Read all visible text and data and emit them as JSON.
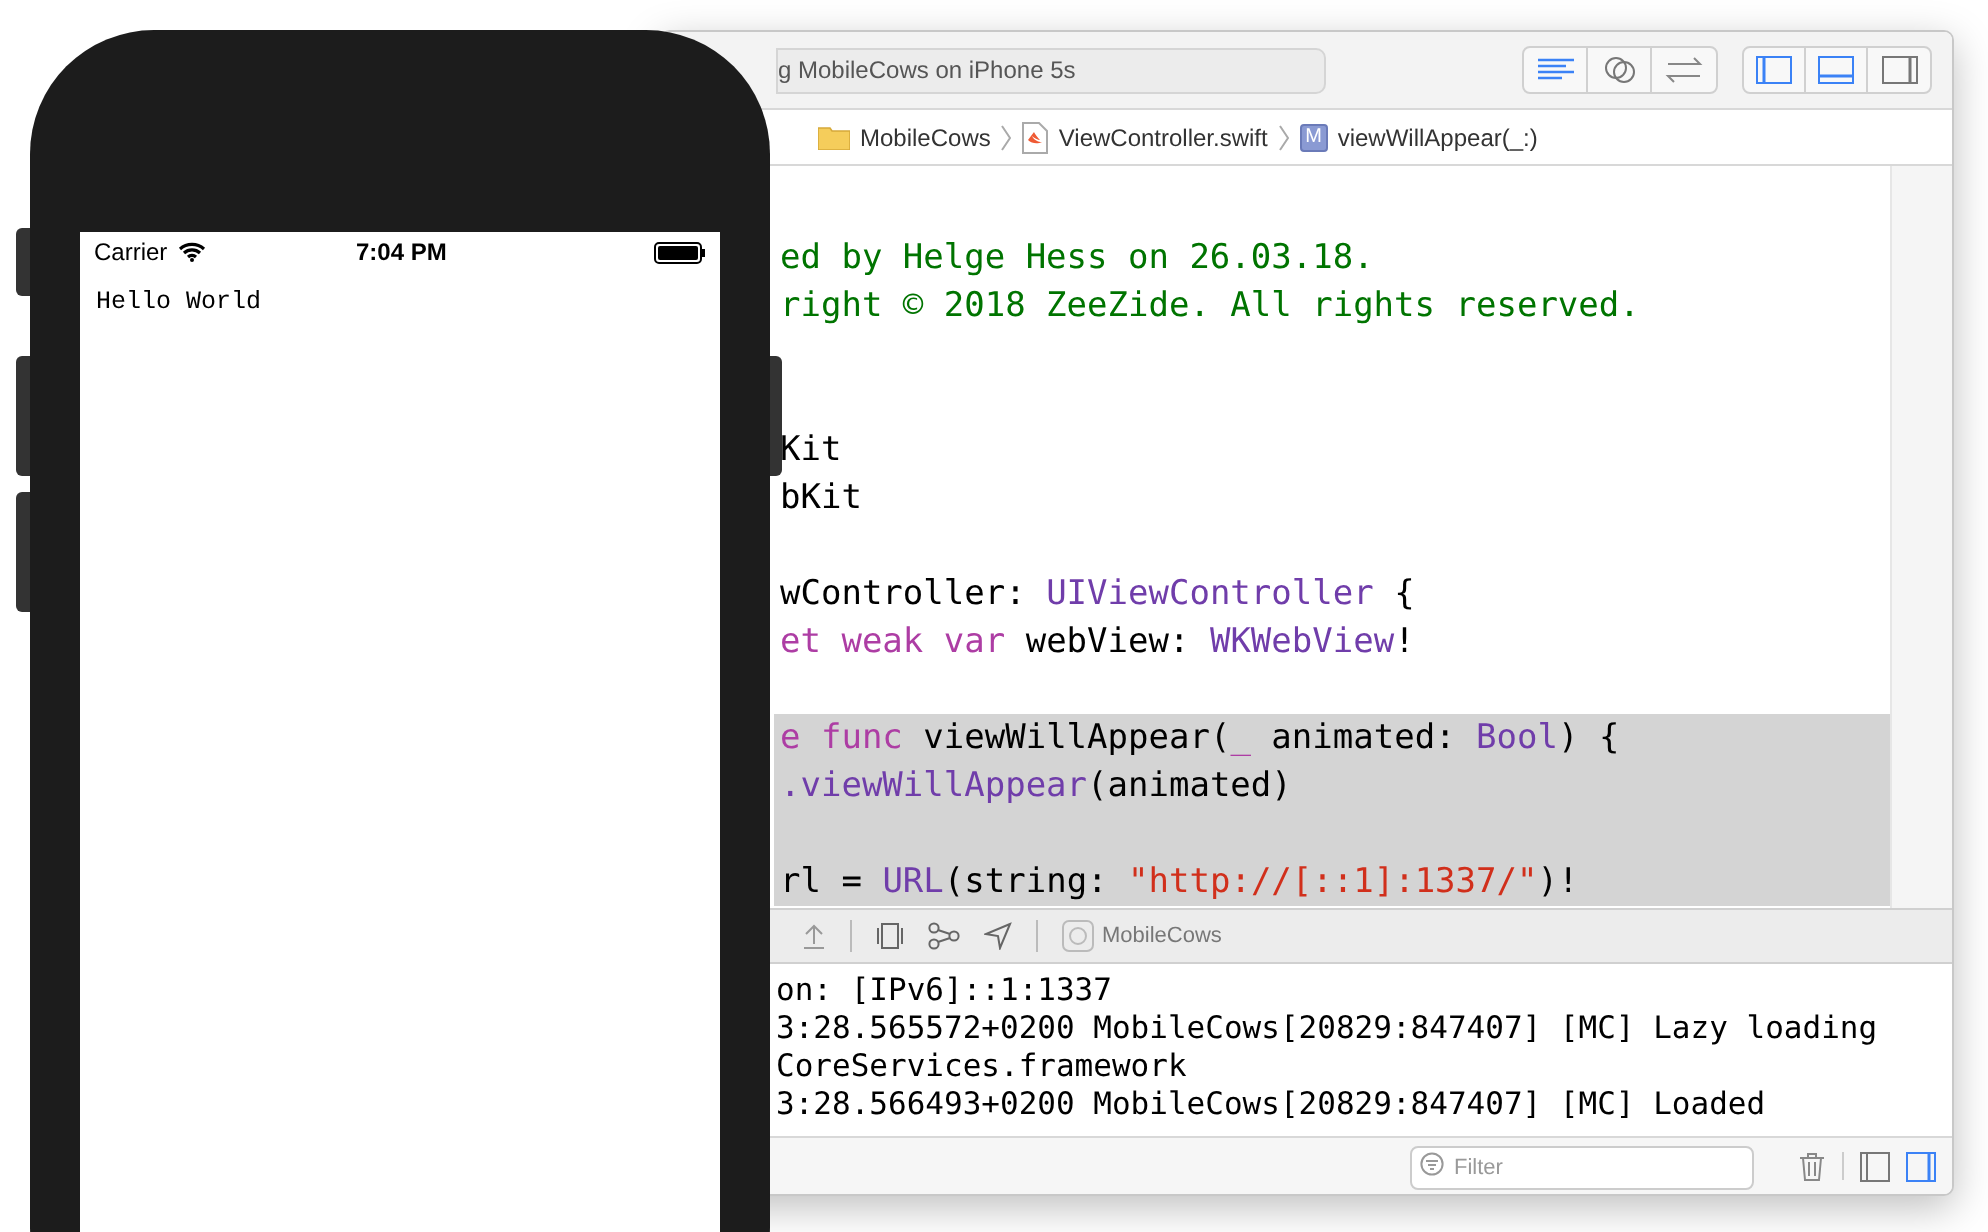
{
  "xcode": {
    "activity": "g MobileCows on iPhone 5s",
    "jump_bar": [
      {
        "label": "MobileCows",
        "kind": "folder"
      },
      {
        "label": "ViewController.swift",
        "kind": "swift"
      },
      {
        "label": "viewWillAppear(_:)",
        "kind": "method",
        "badge": "M"
      }
    ],
    "code_lines": [
      {
        "highlighted": false,
        "tokens": [
          {
            "text": "ed by Helge Hess on 26.03.18.",
            "kind": "comment"
          }
        ]
      },
      {
        "highlighted": false,
        "tokens": [
          {
            "text": "right © 2018 ZeeZide. All rights reserved.",
            "kind": "comment"
          }
        ]
      },
      {
        "highlighted": false
      },
      {
        "highlighted": false
      },
      {
        "highlighted": false,
        "tokens": [
          {
            "text": "Kit",
            "kind": "plain"
          }
        ]
      },
      {
        "highlighted": false,
        "tokens": [
          {
            "text": "bKit",
            "kind": "plain"
          }
        ]
      },
      {
        "highlighted": false
      },
      {
        "highlighted": false,
        "tokens": [
          {
            "text": "wController: ",
            "kind": "plain"
          },
          {
            "text": "UIViewController",
            "kind": "type"
          },
          {
            "text": " {",
            "kind": "plain"
          }
        ]
      },
      {
        "highlighted": false,
        "tokens": [
          {
            "text": "et weak var",
            "kind": "keyword"
          },
          {
            "text": " webView: ",
            "kind": "plain"
          },
          {
            "text": "WKWebView",
            "kind": "type"
          },
          {
            "text": "!",
            "kind": "plain"
          }
        ]
      },
      {
        "highlighted": false
      },
      {
        "highlighted": true,
        "tokens": [
          {
            "text": "e func",
            "kind": "keyword"
          },
          {
            "text": " viewWillAppear(",
            "kind": "plain"
          },
          {
            "text": "_",
            "kind": "keyword"
          },
          {
            "text": " animated: ",
            "kind": "plain"
          },
          {
            "text": "Bool",
            "kind": "type"
          },
          {
            "text": ") {",
            "kind": "plain"
          }
        ]
      },
      {
        "highlighted": true,
        "tokens": [
          {
            "text": ".viewWillAppear",
            "kind": "type"
          },
          {
            "text": "(animated)",
            "kind": "plain"
          }
        ]
      },
      {
        "highlighted": true
      },
      {
        "highlighted": true,
        "tokens": [
          {
            "text": "rl = ",
            "kind": "plain"
          },
          {
            "text": "URL",
            "kind": "type"
          },
          {
            "text": "(string: ",
            "kind": "plain"
          },
          {
            "text": "\"http://[::1]:1337/\"",
            "kind": "string"
          },
          {
            "text": ")!",
            "kind": "plain"
          }
        ]
      }
    ],
    "debug_target": "MobileCows",
    "console_lines": [
      "on: [IPv6]::1:1337",
      "3:28.565572+0200 MobileCows[20829:847407] [MC] Lazy loading",
      "CoreServices.framework",
      "3:28.566493+0200 MobileCows[20829:847407] [MC] Loaded"
    ],
    "filter": {
      "placeholder": "Filter"
    }
  },
  "phone": {
    "carrier": "Carrier",
    "time": "7:04 PM",
    "content": "Hello World"
  }
}
